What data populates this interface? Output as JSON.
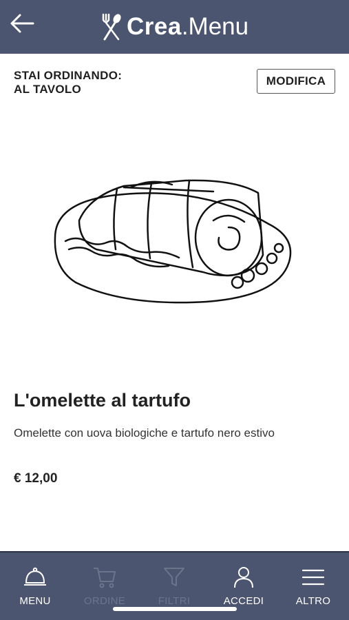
{
  "header": {
    "logo_bold": "Crea",
    "logo_light": ".Menu",
    "back_icon": "arrow-left-icon",
    "logo_icon": "fork-spoon-icon",
    "bg_color": "#4c5570"
  },
  "order_bar": {
    "label_line1": "STAI ORDINANDO:",
    "label_line2": "AL TAVOLO",
    "modify_label": "MODIFICA"
  },
  "dish": {
    "title": "L'omelette al tartufo",
    "description": "Omelette con uova biologiche e tartufo nero estivo",
    "price": "€ 12,00",
    "image_icon": "omelette-illustration"
  },
  "tabbar": {
    "tabs": [
      {
        "label": "MENU",
        "icon": "cloche-icon",
        "state": "active"
      },
      {
        "label": "ORDINE",
        "icon": "cart-icon",
        "state": "disabled"
      },
      {
        "label": "FILTRI",
        "icon": "filter-icon",
        "state": "disabled"
      },
      {
        "label": "ACCEDI",
        "icon": "user-icon",
        "state": "normal"
      },
      {
        "label": "ALTRO",
        "icon": "hamburger-menu-icon",
        "state": "normal"
      }
    ]
  }
}
